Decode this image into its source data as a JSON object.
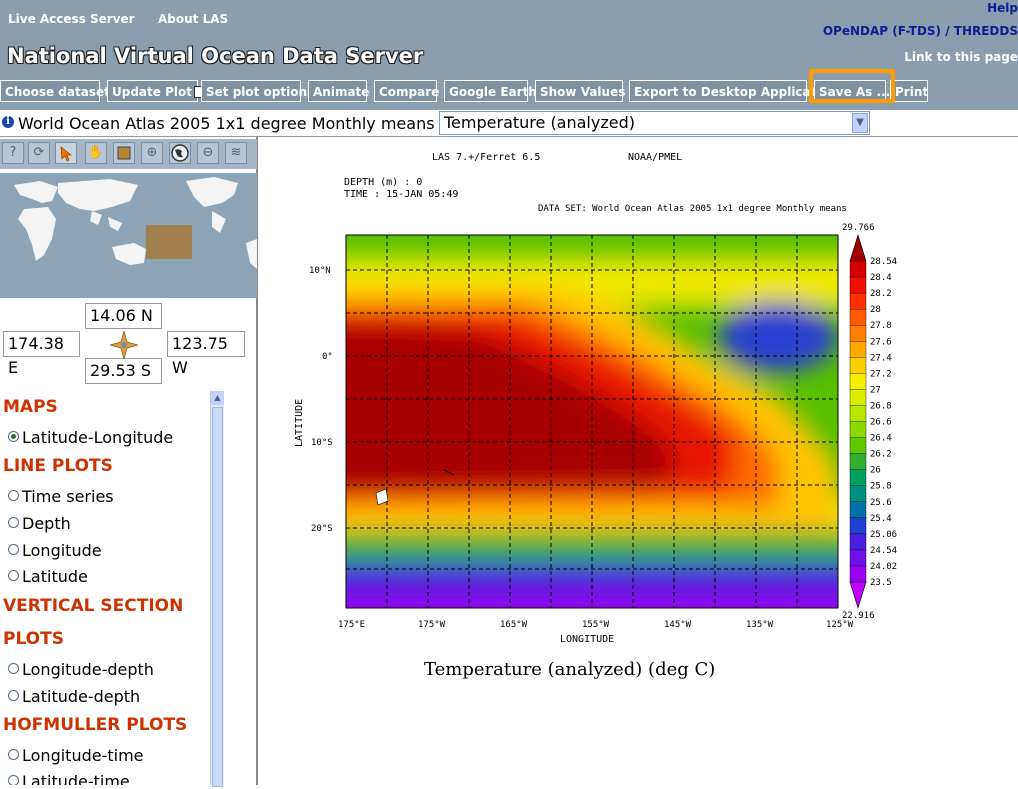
{
  "header": {
    "nav_live_access": "Live Access Server",
    "nav_about": "About LAS",
    "help": "Help",
    "opendap_thredds": "OPeNDAP (F-TDS) / THREDDS",
    "link_to_page": "Link to this page",
    "site_title": "National Virtual Ocean Data Server"
  },
  "toolbar": {
    "choose_dataset": "Choose dataset",
    "update_plot": "Update Plot",
    "set_plot_options": "Set plot options",
    "animate": "Animate",
    "compare": "Compare",
    "google_earth": "Google Earth",
    "show_values": "Show Values",
    "export": "Export to Desktop Application",
    "save_as": "Save As ...",
    "print": "Print"
  },
  "dataset": {
    "name": "World Ocean Atlas 2005 1x1 degree Monthly means",
    "variable": "Temperature (analyzed)"
  },
  "region": {
    "north": "14.06 N",
    "south": "29.53 S",
    "west": "174.38 E",
    "east": "123.75 W"
  },
  "plot_types": {
    "maps": "MAPS",
    "lat_lon": "Latitude-Longitude",
    "line_plots": "LINE PLOTS",
    "time_series": "Time series",
    "depth": "Depth",
    "longitude": "Longitude",
    "latitude": "Latitude",
    "vertical_section": "VERTICAL SECTION",
    "plots": "PLOTS",
    "longitude_depth": "Longitude-depth",
    "latitude_depth": "Latitude-depth",
    "hofmuller": "HOFMULLER PLOTS",
    "longitude_time": "Longitude-time",
    "latitude_time": "Latitude-time"
  },
  "plot": {
    "header_las": "LAS 7.+/Ferret 6.5",
    "header_noaa": "NOAA/PMEL",
    "depth_label": "DEPTH (m) : 0",
    "time_label": "TIME : 15-JAN 05:49",
    "dataset_label": "DATA SET: World Ocean Atlas 2005 1x1 degree Monthly means",
    "caption": "Temperature (analyzed) (deg C)"
  },
  "chart_data": {
    "type": "heatmap",
    "xlabel": "LONGITUDE",
    "ylabel": "LATITUDE",
    "x_ticks": [
      "175°E",
      "175°W",
      "165°W",
      "155°W",
      "145°W",
      "135°W",
      "125°W"
    ],
    "y_ticks": [
      "10°N",
      "0°",
      "10°S",
      "20°S"
    ],
    "colorbar_max": "29.766",
    "colorbar_min": "22.916",
    "colorbar_labels": [
      "28.54",
      "28.4",
      "28.2",
      "28",
      "27.8",
      "27.6",
      "27.4",
      "27.2",
      "27",
      "26.8",
      "26.6",
      "26.4",
      "26.2",
      "26",
      "25.8",
      "25.6",
      "25.4",
      "25.06",
      "24.54",
      "24.02",
      "23.5"
    ],
    "colorbar_colors": [
      "#a00000",
      "#d40000",
      "#f01000",
      "#ff3000",
      "#ff5a00",
      "#ff8000",
      "#ffaa00",
      "#ffd000",
      "#f4f000",
      "#d8f000",
      "#b8e800",
      "#8cd800",
      "#60c800",
      "#30b030",
      "#00a060",
      "#009080",
      "#0070a8",
      "#2040d0",
      "#4a20e0",
      "#7010e8",
      "#9800f0",
      "#c000ff"
    ]
  }
}
